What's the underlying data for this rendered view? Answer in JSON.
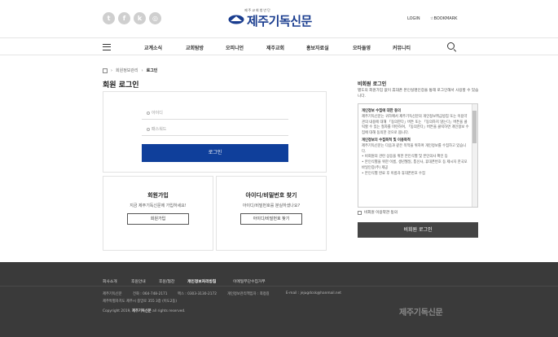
{
  "header": {
    "social_icons": [
      "twitter-icon",
      "facebook-icon",
      "kakao-icon",
      "instagram-icon"
    ],
    "logo_sub": "제주교회청년단",
    "logo_text": "제주기독신문",
    "login": "LOGIN",
    "bookmark": "☆BOOKMARK"
  },
  "nav": {
    "items": [
      "교계소식",
      "교회탐방",
      "오피니언",
      "제주교회",
      "홍보자료실",
      "오타들영",
      "커뮤니티"
    ]
  },
  "breadcrumb": {
    "parent": "회원정보관리",
    "current": "로그인"
  },
  "page_title": "회원 로그인",
  "login": {
    "id_placeholder": "아이디",
    "pw_placeholder": "패스워드",
    "button": "로그인"
  },
  "signup": {
    "title": "회원가입",
    "desc": "지금 제주기독신문에 가입하세요!",
    "button": "회원가입"
  },
  "find": {
    "title": "아이디/비밀번호 찾기",
    "desc": "아이디/비밀번호를 분실하셨나요?",
    "button": "아이디/비밀번호 찾기"
  },
  "guest": {
    "title": "비회원 로그인",
    "desc": "별도의 회원가입 없이 휴대폰 본인실명인증을 통해 로그인해서 사용할 수 있습니다.",
    "terms_h1": "개인정보 수집에 대한 동의",
    "terms_p1": "제주기독신문는 귀하께서 제주기독신문의 개인정보취급방침 또는 이용약관의 내용에 대해 「동의한다」버튼 또는 「동의하지 않는다」버튼을 클릭할 수 있는 절차를 마련하여, 「동의한다」버튼을 클릭하면 개인정보 수집에 대해 동의한 것으로 봅니다.",
    "terms_h2": "개인정보의 수집목적 및 이용목적",
    "terms_p2": "제주기독신문는 다음과 같은 목적을 위하여 개인정보를 수집하고 있습니다.",
    "terms_b1": "• 비회원의 관련 상응을 위한 본인식별 및 본인의사 확인 등",
    "terms_b2": "• 본인식별을 위한 이름, 생년월일, 통신사, 휴대폰번호 등 제시자 한국모바일인증(주) 제공",
    "terms_b3": "• 본인식별 완료 후 이름과 휴대폰번호 수집",
    "agree": "비회원 이용약관 동의",
    "button": "비회원 로그인"
  },
  "footer": {
    "links": [
      "회사소개",
      "후원안내",
      "후원/협찬",
      "개인정보처리방침",
      "이메일무단수집거부"
    ],
    "company": "제주기독신문",
    "tel": "전화 : 064-748-2171",
    "fax": "팩스 : 0303-3130-2172",
    "manager": "개인정보관리책임자 : 최정길",
    "email": "E-mail : jejugdcsk@hanmail.net",
    "address": "제주특별자치도 제주시 중앙로 355 3층 (이도2동)",
    "copyright_pre": "Copyright 2019,",
    "copyright_name": "제주기독신문",
    "copyright_post": "all rights reserved.",
    "logo": "제주기독신문"
  }
}
